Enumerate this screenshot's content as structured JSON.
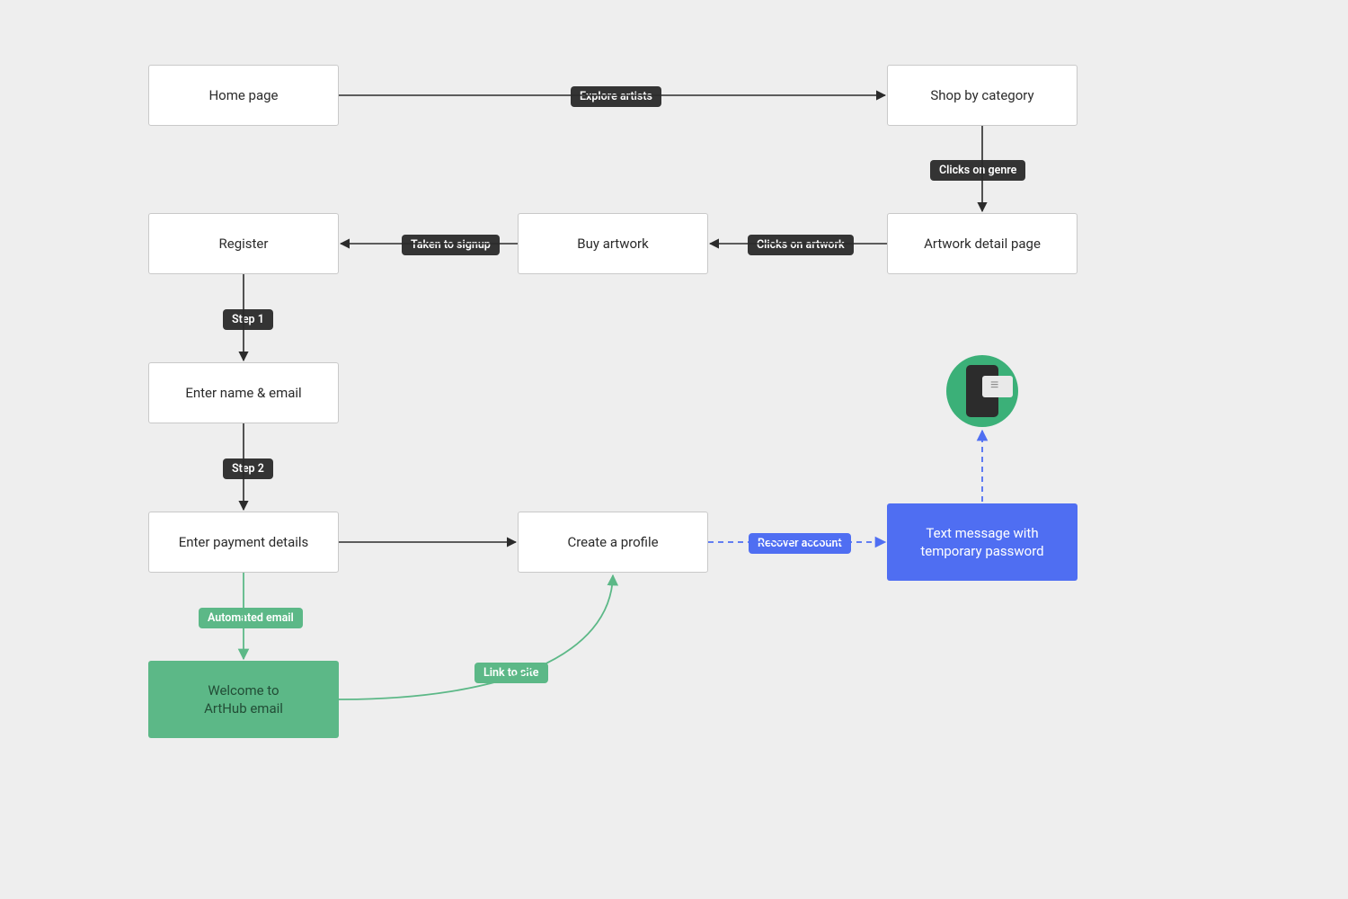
{
  "nodes": {
    "home": "Home page",
    "shop": "Shop by category",
    "detail": "Artwork detail page",
    "buy": "Buy artwork",
    "register": "Register",
    "name_email": "Enter name & email",
    "payment": "Enter payment details",
    "profile": "Create a profile",
    "welcome": "Welcome to\nArtHub email",
    "sms": "Text message with\ntemporary password"
  },
  "edges": {
    "explore": "Explore artists",
    "genre": "Clicks on genre",
    "artwork": "Clicks on artwork",
    "signup": "Taken to signup",
    "step1": "Step 1",
    "step2": "Step 2",
    "auto_email": "Automated email",
    "link": "Link to site",
    "recover": "Recover account"
  },
  "colors": {
    "line_black": "#2b2b2b",
    "line_green": "#5cb887",
    "line_blue": "#4f6ef2"
  },
  "icon": {
    "phone": "phone-message-icon"
  }
}
